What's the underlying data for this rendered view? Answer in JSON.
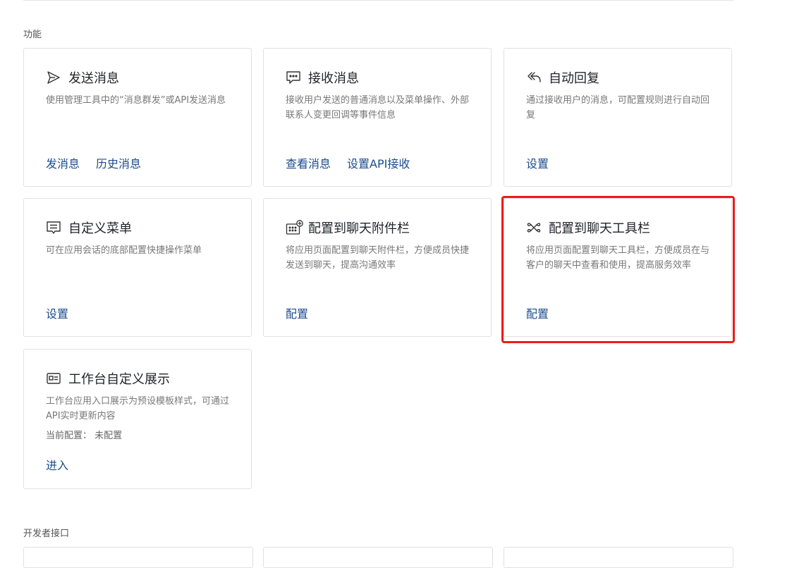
{
  "sections": {
    "features_title": "功能",
    "developer_title": "开发者接口"
  },
  "cards": [
    {
      "icon": "send-icon",
      "title": "发送消息",
      "desc": "使用管理工具中的“消息群发”或API发送消息",
      "links": [
        "发消息",
        "历史消息"
      ]
    },
    {
      "icon": "chat-bubble-icon",
      "title": "接收消息",
      "desc": "接收用户发送的普通消息以及菜单操作、外部联系人变更回调等事件信息",
      "links": [
        "查看消息",
        "设置API接收"
      ]
    },
    {
      "icon": "reply-icon",
      "title": "自动回复",
      "desc": "通过接收用户的消息，可配置规则进行自动回复",
      "links": [
        "设置"
      ]
    },
    {
      "icon": "menu-icon",
      "title": "自定义菜单",
      "desc": "可在应用会话的底部配置快捷操作菜单",
      "links": [
        "设置"
      ]
    },
    {
      "icon": "attachment-bar-icon",
      "title": "配置到聊天附件栏",
      "desc": "将应用页面配置到聊天附件栏，方便成员快捷发送到聊天，提高沟通效率",
      "links": [
        "配置"
      ]
    },
    {
      "icon": "toolbar-icon",
      "title": "配置到聊天工具栏",
      "desc": "将应用页面配置到聊天工具栏，方便成员在与客户的聊天中查看和使用，提高服务效率",
      "links": [
        "配置"
      ]
    },
    {
      "icon": "workbench-icon",
      "title": "工作台自定义展示",
      "desc": "工作台应用入口展示为预设模板样式，可通过API实时更新内容",
      "extra": "当前配置：  未配置",
      "links": [
        "进入"
      ]
    }
  ],
  "colors": {
    "link": "#1b4b8c",
    "highlight": "#ee1b1b",
    "border": "#dfe1e5"
  }
}
